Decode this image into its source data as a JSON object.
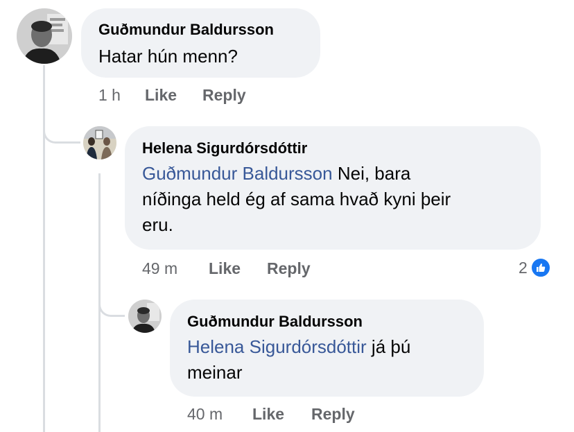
{
  "comments": [
    {
      "author": "Guðmundur Baldursson",
      "mention": "",
      "text": "Hatar hún menn?",
      "time": "1 h",
      "like_label": "Like",
      "reply_label": "Reply"
    },
    {
      "author": "Helena Sigurdórsdóttir",
      "mention": "Guðmundur Baldursson",
      "text_line1": " Nei, bara",
      "text_line2": "níðinga held ég af sama hvað kyni þeir",
      "text_line3": "eru.",
      "time": "49 m",
      "like_label": "Like",
      "reply_label": "Reply",
      "reaction_count": "2",
      "reaction_icon": "thumbs-up-icon"
    },
    {
      "author": "Guðmundur Baldursson",
      "mention": "Helena Sigurdórsdóttir",
      "text_line1": " já þú",
      "text_line2": "meinar",
      "time": "40 m",
      "like_label": "Like",
      "reply_label": "Reply"
    }
  ],
  "colors": {
    "bubble": "#f0f2f5",
    "mention": "#385898",
    "meta": "#65676b",
    "like_badge": "#1877f2",
    "thread_line": "#dadde1"
  }
}
